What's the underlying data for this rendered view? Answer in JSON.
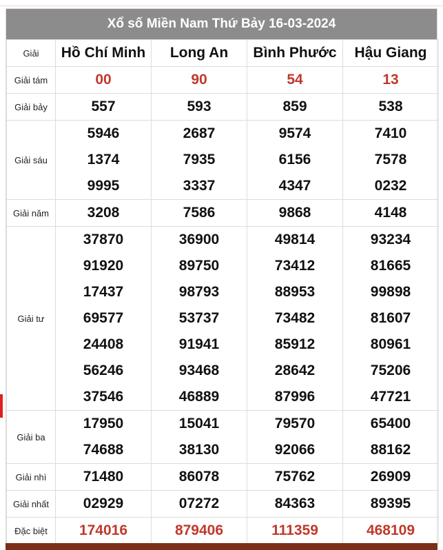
{
  "title": "Xổ số Miền Nam Thứ Bảy 16-03-2024",
  "header_label": "Giải",
  "provinces": [
    "Hồ Chí Minh",
    "Long An",
    "Bình Phước",
    "Hậu Giang"
  ],
  "prizes": [
    {
      "label": "Giải tám",
      "values": [
        [
          "00"
        ],
        [
          "90"
        ],
        [
          "54"
        ],
        [
          "13"
        ]
      ]
    },
    {
      "label": "Giải bảy",
      "values": [
        [
          "557"
        ],
        [
          "593"
        ],
        [
          "859"
        ],
        [
          "538"
        ]
      ]
    },
    {
      "label": "Giải sáu",
      "values": [
        [
          "5946",
          "1374",
          "9995"
        ],
        [
          "2687",
          "7935",
          "3337"
        ],
        [
          "9574",
          "6156",
          "4347"
        ],
        [
          "7410",
          "7578",
          "0232"
        ]
      ]
    },
    {
      "label": "Giải năm",
      "values": [
        [
          "3208"
        ],
        [
          "7586"
        ],
        [
          "9868"
        ],
        [
          "4148"
        ]
      ]
    },
    {
      "label": "Giải tư",
      "values": [
        [
          "37870",
          "91920",
          "17437",
          "69577",
          "24408",
          "56246",
          "37546"
        ],
        [
          "36900",
          "89750",
          "98793",
          "53737",
          "91941",
          "93468",
          "46889"
        ],
        [
          "49814",
          "73412",
          "88953",
          "73482",
          "85912",
          "28642",
          "87996"
        ],
        [
          "93234",
          "81665",
          "99898",
          "81607",
          "80961",
          "75206",
          "47721"
        ]
      ]
    },
    {
      "label": "Giải ba",
      "values": [
        [
          "17950",
          "74688"
        ],
        [
          "15041",
          "38130"
        ],
        [
          "79570",
          "92066"
        ],
        [
          "65400",
          "88162"
        ]
      ]
    },
    {
      "label": "Giải nhì",
      "values": [
        [
          "71480"
        ],
        [
          "86078"
        ],
        [
          "75762"
        ],
        [
          "26909"
        ]
      ]
    },
    {
      "label": "Giải nhất",
      "values": [
        [
          "02929"
        ],
        [
          "07272"
        ],
        [
          "84363"
        ],
        [
          "89395"
        ]
      ]
    },
    {
      "label": "Đặc biệt",
      "values": [
        [
          "174016"
        ],
        [
          "879406"
        ],
        [
          "111359"
        ],
        [
          "468109"
        ]
      ]
    }
  ],
  "colors": {
    "title_bg": "#8c8c8c",
    "highlight": "#c0392b",
    "bottom_bar": "#7a2f16"
  }
}
